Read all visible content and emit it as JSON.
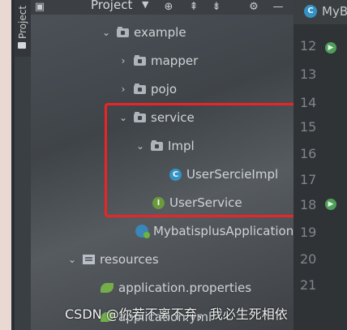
{
  "side_tab": {
    "label": "Project"
  },
  "toolbar": {
    "title": "Project",
    "icons": [
      "project-view-icon",
      "caret-down-icon",
      "target-icon",
      "expand-all-icon",
      "collapse-all-icon",
      "gear-icon",
      "minimize-icon"
    ]
  },
  "editor_tab": {
    "label": "MyB"
  },
  "tree": {
    "rows": [
      {
        "label": "example",
        "type": "package",
        "expanded": true
      },
      {
        "label": "mapper",
        "type": "package",
        "expanded": false
      },
      {
        "label": "pojo",
        "type": "package",
        "expanded": false
      },
      {
        "label": "service",
        "type": "package",
        "expanded": true
      },
      {
        "label": "Impl",
        "type": "package",
        "expanded": true
      },
      {
        "label": "UserSercieImpl",
        "type": "class",
        "icon_letter": "C"
      },
      {
        "label": "UserService",
        "type": "interface",
        "icon_letter": "I"
      },
      {
        "label": "MybatisplusApplication",
        "type": "spring-class"
      },
      {
        "label": "resources",
        "type": "resources-folder",
        "expanded": true
      },
      {
        "label": "application.properties",
        "type": "properties"
      },
      {
        "label": "application.yml",
        "type": "properties"
      }
    ]
  },
  "gutter": {
    "line_numbers": [
      "12",
      "13",
      "14",
      "15",
      "16",
      "17",
      "18",
      "19",
      "20",
      "21"
    ]
  },
  "watermark": {
    "text": "CSDN @你若不离不弃，我必生死相依"
  },
  "colors": {
    "highlight": "#ee2326",
    "class_icon": "#3592c4",
    "interface_icon": "#6a9a3b"
  }
}
